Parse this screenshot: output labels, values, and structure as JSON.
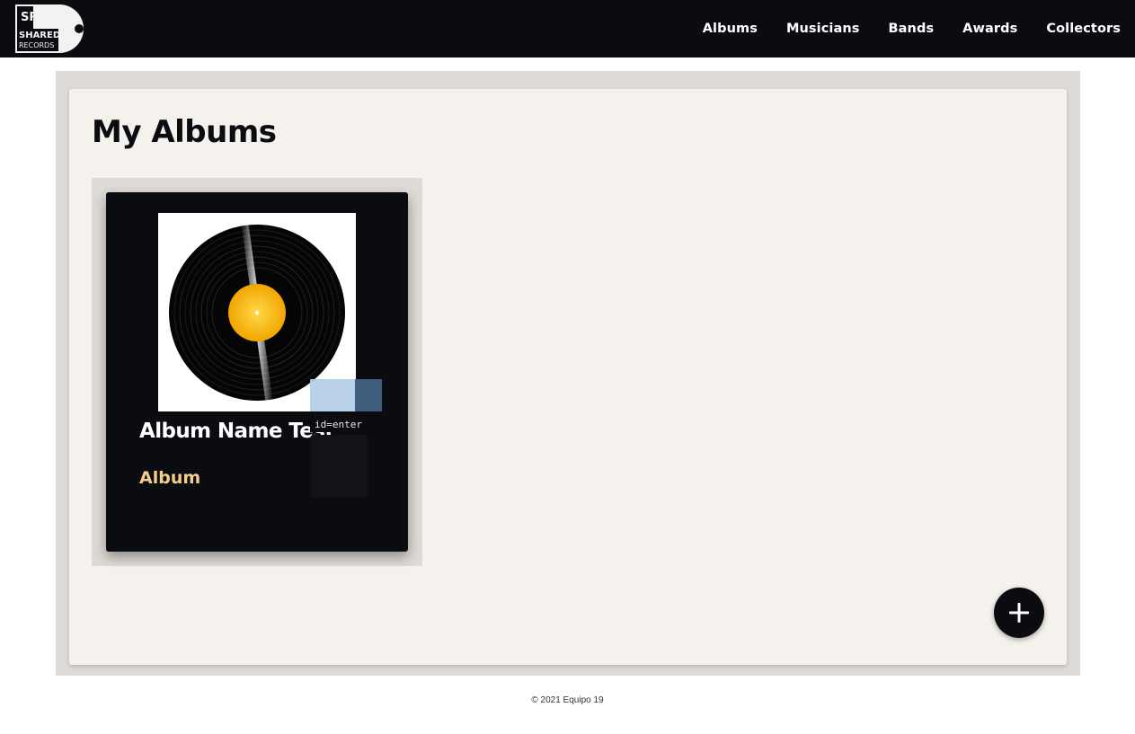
{
  "brand": {
    "logo_initials": "SR",
    "logo_line1": "SHARED",
    "logo_line2": "RECORDS"
  },
  "nav": {
    "items": [
      {
        "label": "Albums"
      },
      {
        "label": "Musicians"
      },
      {
        "label": "Bands"
      },
      {
        "label": "Awards"
      },
      {
        "label": "Collectors"
      }
    ]
  },
  "page": {
    "title": "My Albums"
  },
  "albums": [
    {
      "name": "Album Name Test",
      "type": "Album",
      "cover_icon": "vinyl-record-icon"
    }
  ],
  "overlay": {
    "id_label": "id=enter"
  },
  "fab": {
    "icon": "plus-icon"
  },
  "footer": {
    "text": "© 2021 Equipo 19"
  },
  "colors": {
    "navbar": "#0b0c10",
    "panel_outer": "#dedad5",
    "panel_inner": "#f5f1ec",
    "card": "#0b0c10",
    "album_type_accent": "#f5cf8a",
    "vinyl_label": "#f7b500"
  }
}
